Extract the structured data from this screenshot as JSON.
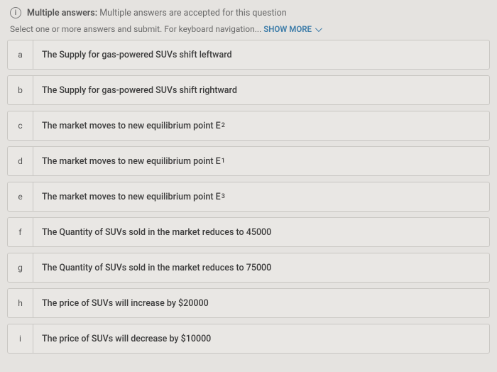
{
  "header": {
    "label": "Multiple answers:",
    "text": "Multiple answers are accepted for this question"
  },
  "instruction": {
    "prefix": "Select one or more answers and submit. For keyboard navigation... ",
    "show_more": "SHOW MORE"
  },
  "options": [
    {
      "key": "a",
      "text": "The Supply for gas-powered SUVs shift leftward"
    },
    {
      "key": "b",
      "text": "The Supply for gas-powered SUVs shift rightward"
    },
    {
      "key": "c",
      "text_pre": "The market moves to new equilibrium point E",
      "sub": "2"
    },
    {
      "key": "d",
      "text_pre": "The market moves to new equilibrium point E",
      "sub": "1"
    },
    {
      "key": "e",
      "text_pre": "The market moves to new equilibrium point E",
      "sub": "3"
    },
    {
      "key": "f",
      "text": "The Quantity of SUVs sold in the market reduces to 45000"
    },
    {
      "key": "g",
      "text": "The Quantity of SUVs sold in the market reduces to 75000"
    },
    {
      "key": "h",
      "text": "The price of SUVs will increase by $20000"
    },
    {
      "key": "i",
      "text": "The price of SUVs will decrease by $10000"
    }
  ]
}
